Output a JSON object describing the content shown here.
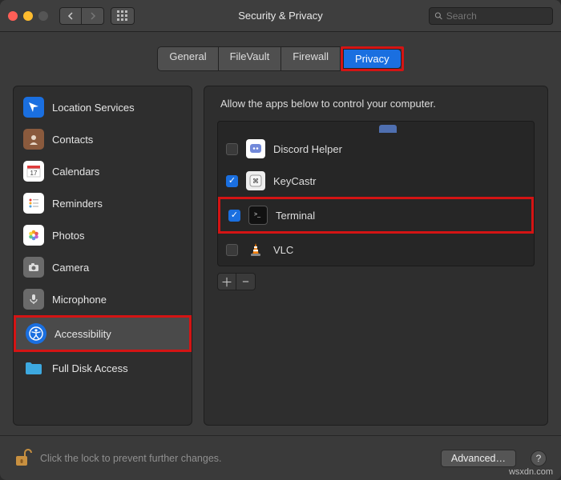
{
  "window": {
    "title": "Security & Privacy"
  },
  "search": {
    "placeholder": "Search"
  },
  "tabs": [
    {
      "label": "General"
    },
    {
      "label": "FileVault"
    },
    {
      "label": "Firewall"
    },
    {
      "label": "Privacy",
      "active": true
    }
  ],
  "sidebar": {
    "items": [
      {
        "label": "Location Services",
        "icon": "location-icon",
        "color": "#1a6fe0"
      },
      {
        "label": "Contacts",
        "icon": "contacts-icon",
        "color": "#8a5a3d"
      },
      {
        "label": "Calendars",
        "icon": "calendar-icon",
        "color": "#ffffff"
      },
      {
        "label": "Reminders",
        "icon": "reminders-icon",
        "color": "#ffffff"
      },
      {
        "label": "Photos",
        "icon": "photos-icon",
        "color": "#ffffff"
      },
      {
        "label": "Camera",
        "icon": "camera-icon",
        "color": "#6b6b6b"
      },
      {
        "label": "Microphone",
        "icon": "microphone-icon",
        "color": "#6b6b6b"
      },
      {
        "label": "Accessibility",
        "icon": "accessibility-icon",
        "color": "#1a6fe0",
        "selected": true
      },
      {
        "label": "Full Disk Access",
        "icon": "folder-icon",
        "color": "#3da9e0"
      }
    ]
  },
  "main": {
    "description": "Allow the apps below to control your computer.",
    "apps": [
      {
        "name": "Discord Helper",
        "checked": false,
        "icon": "discord-icon"
      },
      {
        "name": "KeyCastr",
        "checked": true,
        "icon": "keycastr-icon"
      },
      {
        "name": "Terminal",
        "checked": true,
        "icon": "terminal-icon",
        "highlighted": true
      },
      {
        "name": "VLC",
        "checked": false,
        "icon": "vlc-icon"
      }
    ]
  },
  "footer": {
    "lock_text": "Click the lock to prevent further changes.",
    "advanced_label": "Advanced…"
  },
  "watermark": "wsxdn.com"
}
